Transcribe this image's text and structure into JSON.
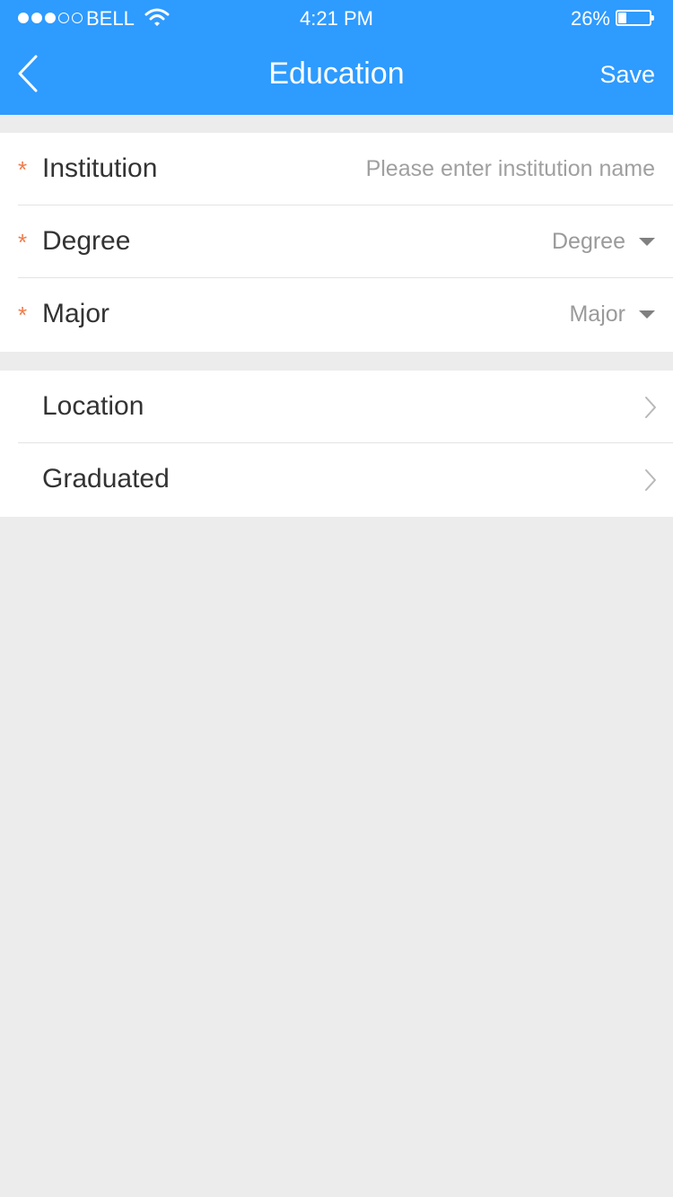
{
  "status_bar": {
    "carrier": "BELL",
    "time": "4:21 PM",
    "battery_percent": "26%",
    "battery_level": 0.26,
    "signal_strength": 3,
    "signal_max": 5
  },
  "nav": {
    "title": "Education",
    "save_label": "Save",
    "back_icon": "chevron-left-icon"
  },
  "form": {
    "required_mark": "*",
    "institution": {
      "label": "Institution",
      "placeholder": "Please enter institution name",
      "value": ""
    },
    "degree": {
      "label": "Degree",
      "selected": "Degree"
    },
    "major": {
      "label": "Major",
      "selected": "Major"
    }
  },
  "details": {
    "location": {
      "label": "Location"
    },
    "graduated": {
      "label": "Graduated"
    }
  },
  "colors": {
    "header_bg": "#2e9bff",
    "required": "#f07c4a",
    "page_bg": "#ececec"
  }
}
